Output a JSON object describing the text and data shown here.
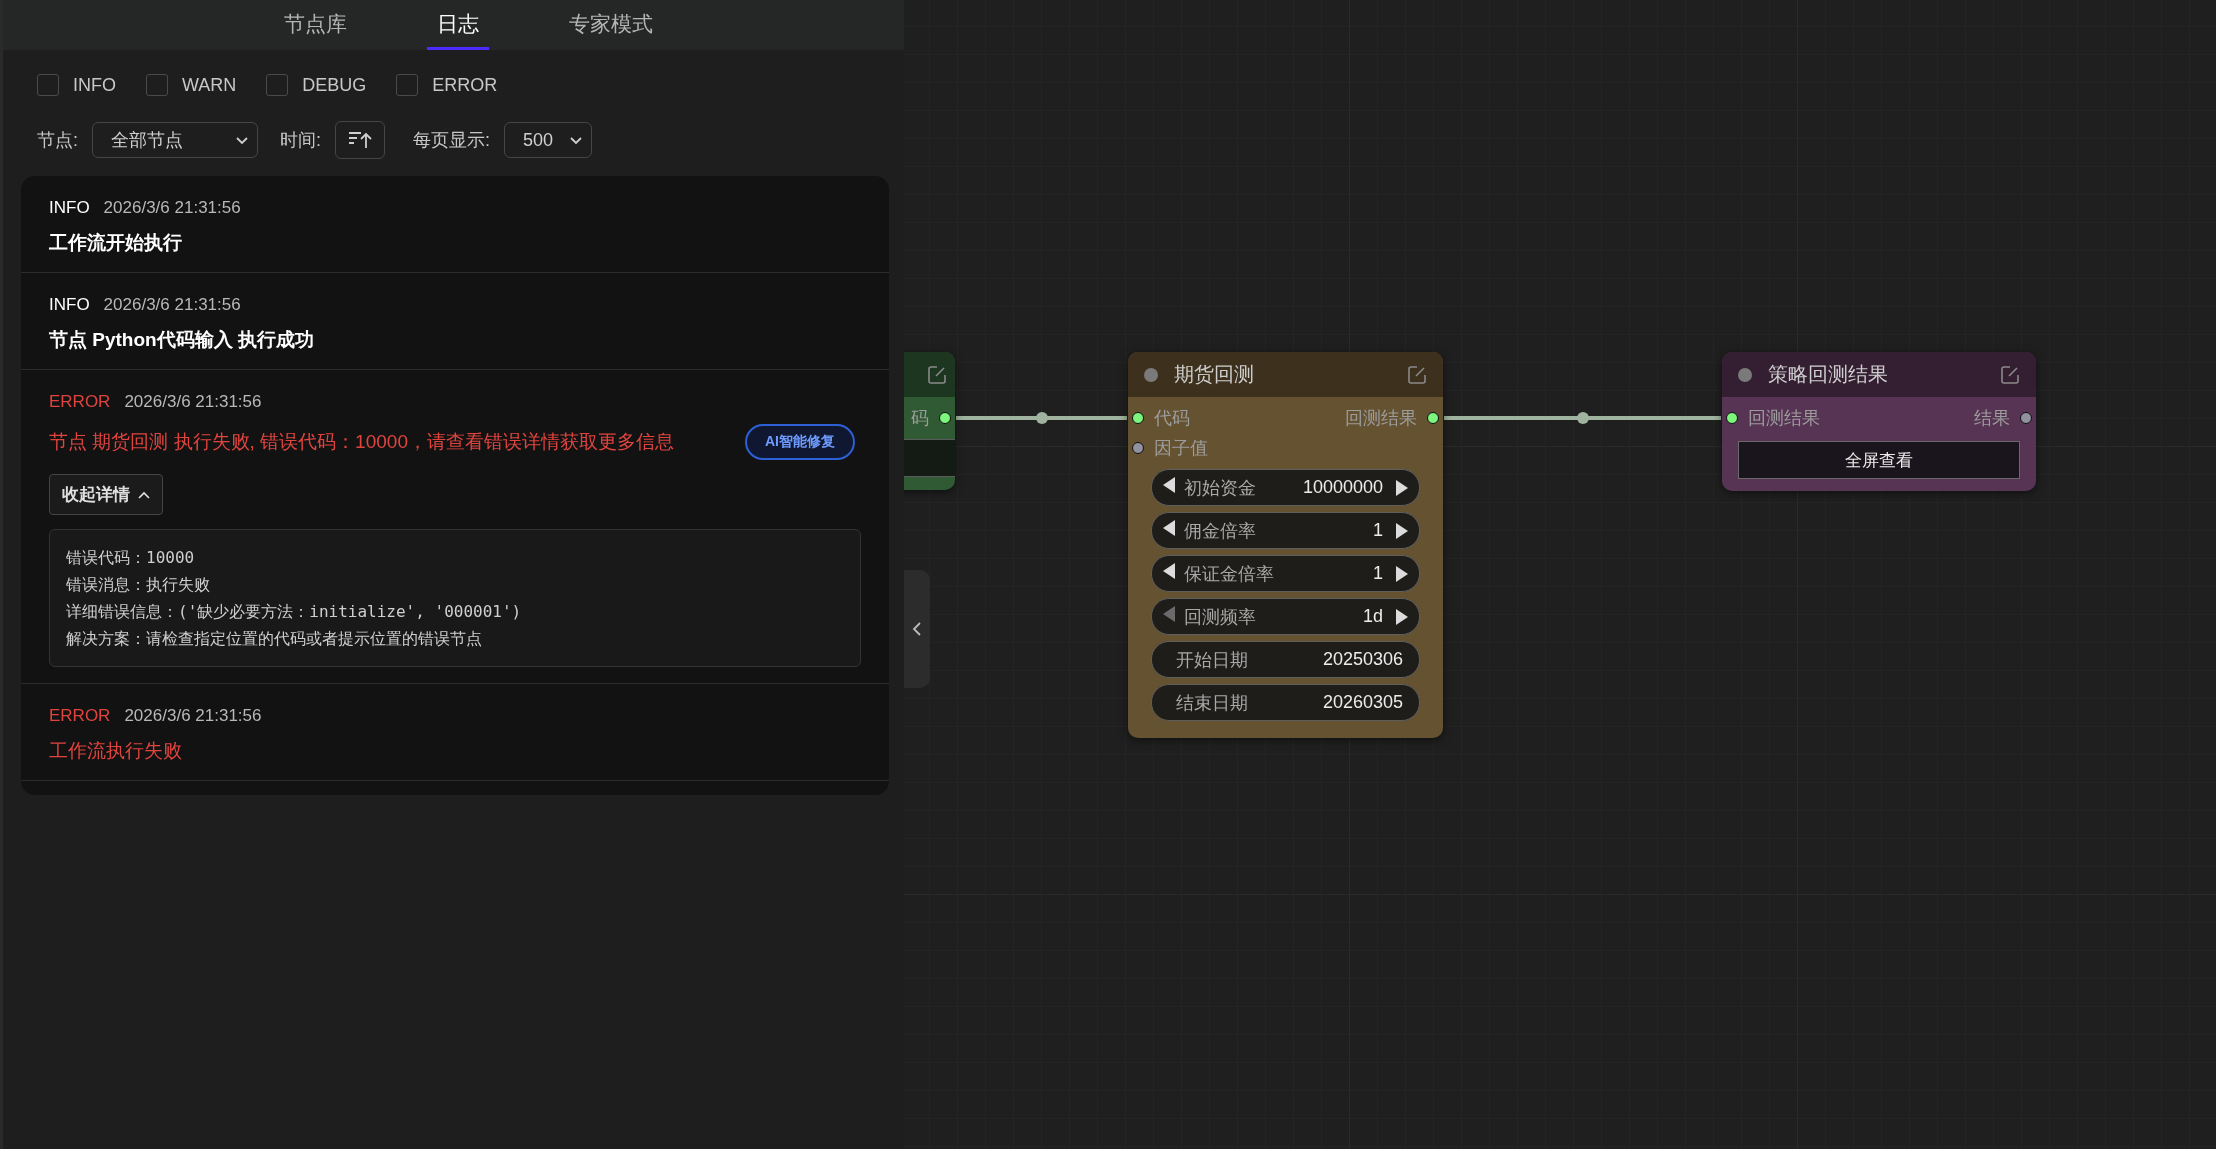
{
  "sidebar": {
    "tabs": [
      {
        "label": "节点库",
        "selected": false
      },
      {
        "label": "日志",
        "selected": true
      },
      {
        "label": "专家模式",
        "selected": false
      }
    ],
    "level_filters": [
      {
        "label": "INFO",
        "checked": false
      },
      {
        "label": "WARN",
        "checked": false
      },
      {
        "label": "DEBUG",
        "checked": false
      },
      {
        "label": "ERROR",
        "checked": false
      }
    ],
    "node_filter": {
      "label": "节点:",
      "value": "全部节点"
    },
    "time_sort": {
      "label": "时间:"
    },
    "page_size": {
      "label": "每页显示:",
      "value": "500"
    },
    "logs": [
      {
        "kind": "info",
        "level": "INFO",
        "time": "2026/3/6 21:31:56",
        "message": "工作流开始执行"
      },
      {
        "kind": "info",
        "level": "INFO",
        "time": "2026/3/6 21:31:56",
        "message": "节点 Python代码输入 执行成功"
      },
      {
        "kind": "error",
        "level": "ERROR",
        "time": "2026/3/6 21:31:56",
        "message": "节点 期货回测 执行失败, 错误代码：10000，请查看错误详情获取更多信息",
        "ai_fix": "AI智能修复",
        "details_toggle": "收起详情",
        "expanded": true,
        "details": [
          "错误代码：10000",
          "错误消息：执行失败",
          "详细错误信息：('缺少必要方法：initialize', '000001')",
          "解决方案：请检查指定位置的代码或者提示位置的错误节点"
        ]
      },
      {
        "kind": "error",
        "level": "ERROR",
        "time": "2026/3/6 21:31:56",
        "message": "工作流执行失败"
      }
    ]
  },
  "canvas": {
    "nodes": [
      {
        "kind": "partial",
        "color": "#2f5a33",
        "outputs": [
          {
            "label": "码",
            "connected": true
          }
        ]
      },
      {
        "kind": "full",
        "color": "#655231",
        "title": "期货回测",
        "inputs": [
          {
            "label": "代码",
            "connected": true
          },
          {
            "label": "因子值",
            "connected": false
          }
        ],
        "outputs": [
          {
            "label": "回测结果",
            "connected": true
          }
        ],
        "widgets": [
          {
            "kind": "stepper",
            "label": "初始资金",
            "value": "10000000",
            "left_disabled": false
          },
          {
            "kind": "stepper",
            "label": "佣金倍率",
            "value": "1",
            "left_disabled": false
          },
          {
            "kind": "stepper",
            "label": "保证金倍率",
            "value": "1",
            "left_disabled": false
          },
          {
            "kind": "stepper",
            "label": "回测频率",
            "value": "1d",
            "left_disabled": true
          },
          {
            "kind": "text",
            "label": "开始日期",
            "value": "20250306"
          },
          {
            "kind": "text",
            "label": "结束日期",
            "value": "20260305"
          }
        ]
      },
      {
        "kind": "full",
        "color": "#573354",
        "title": "策略回测结果",
        "inputs": [
          {
            "label": "回测结果",
            "connected": true
          }
        ],
        "outputs": [
          {
            "label": "结果",
            "connected": false
          }
        ],
        "button": "全屏查看"
      }
    ]
  }
}
